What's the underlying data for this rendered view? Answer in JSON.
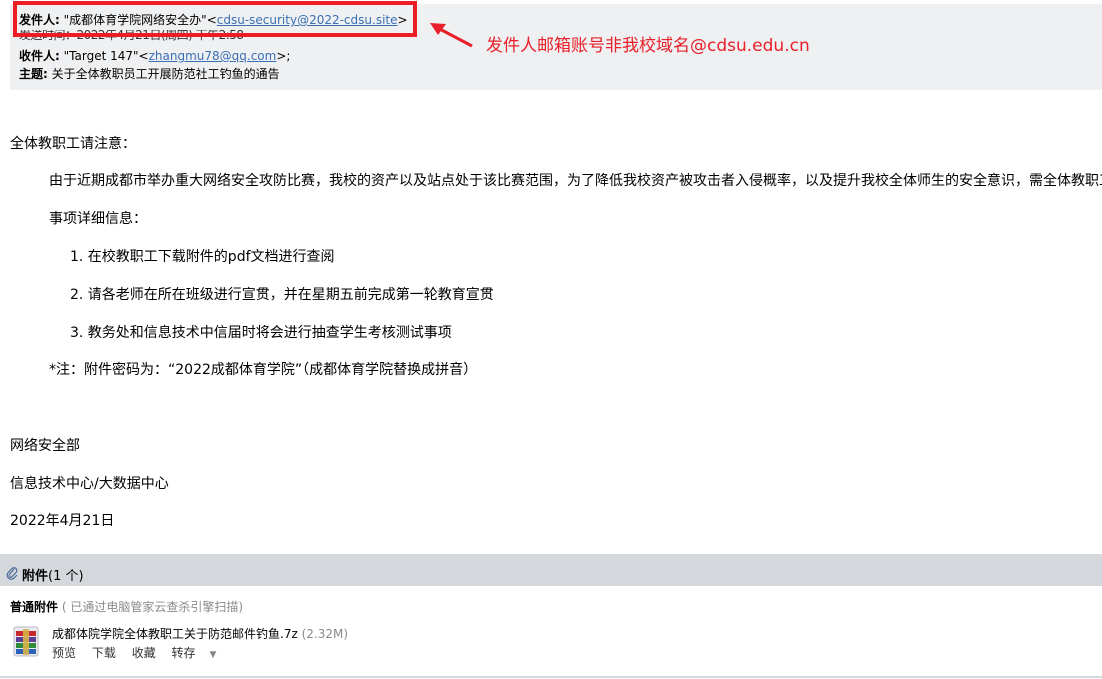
{
  "header": {
    "from_label": "发件人:",
    "from_name": "\"成都体育学院网络安全办\"",
    "from_email": "cdsu-security@2022-cdsu.site",
    "lt": "<",
    "gt": ">",
    "time_row_garbled": "发送时间：2022年4月21日(周四) 下午2:58",
    "to_label": "收件人:",
    "to_name": "\"Target 147\"",
    "to_email": "zhangmu78@qq.com",
    "to_suffix": ">;",
    "subject_label": "主题:",
    "subject": "关于全体教职员工开展防范社工钓鱼的通告"
  },
  "annotation": {
    "text": "发件人邮箱账号非我校域名@cdsu.edu.cn",
    "color": "#e8202a"
  },
  "body": {
    "greeting": "全体教职工请注意：",
    "para1": "由于近期成都市举办重大网络安全攻防比赛，我校的资产以及站点处于该比赛范围，为了降低我校资产被攻击者入侵概率，以及提升我校全体师生的安全意识，需全体教职工",
    "details_heading": "事项详细信息：",
    "items": [
      "1. 在校教职工下载附件的pdf文档进行查阅",
      "2. 请各老师在所在班级进行宣贯，并在星期五前完成第一轮教育宣贯",
      "3. 教务处和信息技术中信届时将会进行抽查学生考核测试事项"
    ],
    "note": "*注：附件密码为：“2022成都体育学院”（成都体育学院替换成拼音）",
    "sign_dept": "网络安全部",
    "sign_center": "信息技术中心/大数据中心",
    "sign_date": "2022年4月21日"
  },
  "attachments": {
    "title": "附件",
    "count": "(1 个)",
    "normal_label": "普通附件",
    "scan_text": "( 已通过电脑管家云查杀引擎扫描)",
    "file_name": "成都体院学院全体教职工关于防范邮件钓鱼.7z",
    "file_size": "(2.32M)",
    "actions": [
      "预览",
      "下载",
      "收藏",
      "转存"
    ]
  },
  "colors": {
    "highlight_border": "#ee1c25",
    "header_bg": "#eff0f2",
    "link": "#3a6fb5",
    "attachment_bar": "#d4d7dc"
  }
}
